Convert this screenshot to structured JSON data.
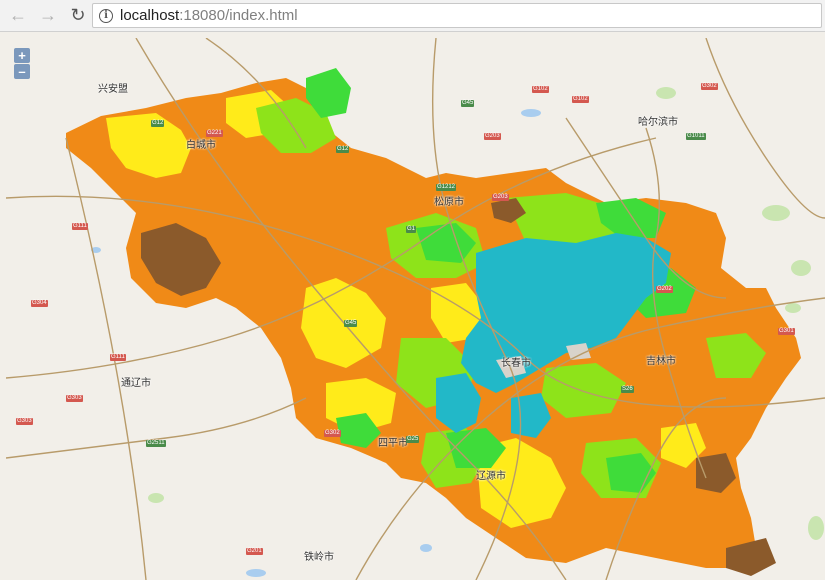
{
  "browser": {
    "back_icon": "arrow-left-icon",
    "forward_icon": "arrow-right-icon",
    "reload_icon": "reload-icon",
    "info_icon": "info-icon",
    "url_host": "localhost",
    "url_rest": ":18080/index.html"
  },
  "zoom": {
    "in_label": "+",
    "out_label": "–"
  },
  "colors": {
    "orange": "#f08a17",
    "dark_orange": "#e06b10",
    "brown": "#8b5a2b",
    "yellow": "#ffeb1a",
    "lime": "#8ee31a",
    "green": "#3fdc3a",
    "cyan": "#22b8c8",
    "land": "#f2efe9",
    "water": "#a9cdef",
    "road": "#b89b6a"
  },
  "cities": [
    {
      "id": "white-city",
      "label": "白城市"
    },
    {
      "id": "songyuan",
      "label": "松原市"
    },
    {
      "id": "changchun",
      "label": "长春市"
    },
    {
      "id": "jilin",
      "label": "吉林市"
    },
    {
      "id": "siping",
      "label": "四平市"
    },
    {
      "id": "liaoyuan",
      "label": "辽源市"
    },
    {
      "id": "harbin",
      "label": "哈尔滨市"
    },
    {
      "id": "tongliao",
      "label": "通辽市"
    },
    {
      "id": "tieling",
      "label": "铁岭市"
    },
    {
      "id": "west-city",
      "label": "兴安盟"
    }
  ],
  "roads": [
    {
      "id": "r1",
      "label": "G12",
      "color": "green"
    },
    {
      "id": "r2",
      "label": "G45",
      "color": "green"
    },
    {
      "id": "r3",
      "label": "G1",
      "color": "green"
    },
    {
      "id": "r4",
      "label": "G25",
      "color": "green"
    },
    {
      "id": "r5",
      "label": "G12",
      "color": "green"
    },
    {
      "id": "r6",
      "label": "G1011",
      "color": "green"
    },
    {
      "id": "r7",
      "label": "G45",
      "color": "green"
    },
    {
      "id": "r8",
      "label": "G2511",
      "color": "green"
    },
    {
      "id": "r9",
      "label": "G1212",
      "color": "green"
    },
    {
      "id": "r10",
      "label": "S26",
      "color": "green"
    },
    {
      "id": "r11",
      "label": "G203",
      "color": "red"
    },
    {
      "id": "r12",
      "label": "G302",
      "color": "red"
    },
    {
      "id": "r13",
      "label": "G111",
      "color": "red"
    },
    {
      "id": "r14",
      "label": "G304",
      "color": "red"
    },
    {
      "id": "r15",
      "label": "G303",
      "color": "red"
    },
    {
      "id": "r16",
      "label": "G102",
      "color": "red"
    },
    {
      "id": "r17",
      "label": "G202",
      "color": "red"
    },
    {
      "id": "r18",
      "label": "G221",
      "color": "red"
    },
    {
      "id": "r19",
      "label": "G201",
      "color": "red"
    },
    {
      "id": "r20",
      "label": "G301",
      "color": "red"
    },
    {
      "id": "r21",
      "label": "G203",
      "color": "red"
    },
    {
      "id": "r22",
      "label": "G102",
      "color": "red"
    },
    {
      "id": "r23",
      "label": "G302",
      "color": "red"
    },
    {
      "id": "r24",
      "label": "G111",
      "color": "red"
    },
    {
      "id": "r25",
      "label": "G303",
      "color": "red"
    }
  ]
}
